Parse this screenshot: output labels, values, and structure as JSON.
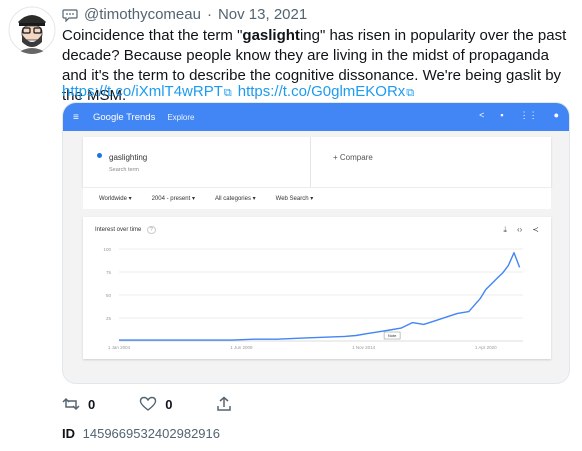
{
  "tweet": {
    "handle": "@timothycomeau",
    "separator": "·",
    "date": "Nov 13, 2021",
    "text_before": "Coincidence that the term \"",
    "text_bold": "gaslight",
    "text_after": "ing\" has risen in popularity over the past decade? Because people know they are living in the midst of propaganda and it's the term to describe the cognitive dissonance. We're being gaslit by the MSM.",
    "link1": "https://t.co/iXmlT4wRPT",
    "link2": "https://t.co/G0glmEKORx",
    "link_icon": "external-link-icon"
  },
  "trends": {
    "menu_icon": "hamburger-icon",
    "brand": "Google Trends",
    "explore": "Explore",
    "term": "gaslighting",
    "term_sub": "Search term",
    "compare": "+ Compare",
    "filters": [
      "Worldwide ▾",
      "2004 - present ▾",
      "All categories ▾",
      "Web Search ▾"
    ],
    "chart_title": "Interest over time",
    "help_icon": "?",
    "share_icon": "share-icon",
    "feedback_icon": "feedback-icon",
    "apps_icon": "apps-icon"
  },
  "chart_data": {
    "type": "line",
    "title": "Interest over time",
    "x_tick_labels": [
      "1 Jan 2004",
      "1 Jun 2009",
      "1 Nov 2014",
      "1 Apr 2020"
    ],
    "y_tick_labels": [
      "100",
      "75",
      "50",
      "25"
    ],
    "ylim": [
      0,
      100
    ],
    "annotation": "Note",
    "grid": true,
    "series": [
      {
        "color": "#4285f4",
        "x": [
          2004,
          2005,
          2006,
          2007,
          2008,
          2009,
          2010,
          2011,
          2012,
          2013,
          2014,
          2014.5,
          2015,
          2015.5,
          2016,
          2016.5,
          2017,
          2017.5,
          2018,
          2018.5,
          2019,
          2019.5,
          2020,
          2020.25,
          2020.5,
          2020.75,
          2021,
          2021.25,
          2021.5,
          2021.75
        ],
        "values": [
          1,
          1,
          1,
          1,
          1,
          1,
          2,
          2,
          3,
          4,
          5,
          6,
          8,
          10,
          12,
          14,
          20,
          18,
          22,
          26,
          30,
          32,
          46,
          56,
          62,
          68,
          74,
          82,
          96,
          80
        ]
      }
    ]
  },
  "stats": {
    "retweets": "0",
    "likes": "0"
  },
  "id": {
    "label": "ID",
    "value": "1459669532402982916"
  }
}
